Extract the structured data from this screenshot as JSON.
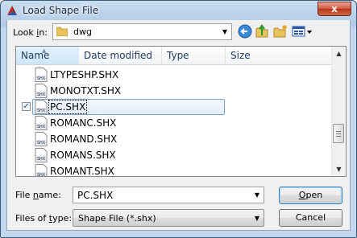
{
  "window": {
    "title": "Load Shape File",
    "close_label": "x"
  },
  "lookin": {
    "label_pre": "Look ",
    "label_accel": "i",
    "label_post": "n:",
    "value": "dwg"
  },
  "toolbar": {
    "back_icon": "back-arrow-icon",
    "up_icon": "up-folder-icon",
    "new_folder_icon": "new-folder-icon",
    "views_icon": "views-menu-icon"
  },
  "columns": [
    {
      "label": "Name"
    },
    {
      "label": "Date modified"
    },
    {
      "label": "Type"
    },
    {
      "label": "Size"
    }
  ],
  "files": [
    {
      "name": "LTYPESHP.SHX",
      "selected": false
    },
    {
      "name": "MONOTXT.SHX",
      "selected": false
    },
    {
      "name": "PC.SHX",
      "selected": true
    },
    {
      "name": "ROMANC.SHX",
      "selected": false
    },
    {
      "name": "ROMAND.SHX",
      "selected": false
    },
    {
      "name": "ROMANS.SHX",
      "selected": false
    },
    {
      "name": "ROMANT.SHX",
      "selected": false
    }
  ],
  "file_icon_label": "SHX",
  "filename": {
    "label_pre": "File ",
    "label_accel": "n",
    "label_post": "ame:",
    "value": "PC.SHX"
  },
  "filetype": {
    "label_pre": "Files of ",
    "label_accel": "t",
    "label_post": "ype:",
    "value": "Shape File (*.shx)"
  },
  "buttons": {
    "open_accel": "O",
    "open_rest": "pen",
    "cancel": "Cancel"
  },
  "colors": {
    "selection_border": "#7da2ce",
    "header_text": "#1e395b"
  }
}
